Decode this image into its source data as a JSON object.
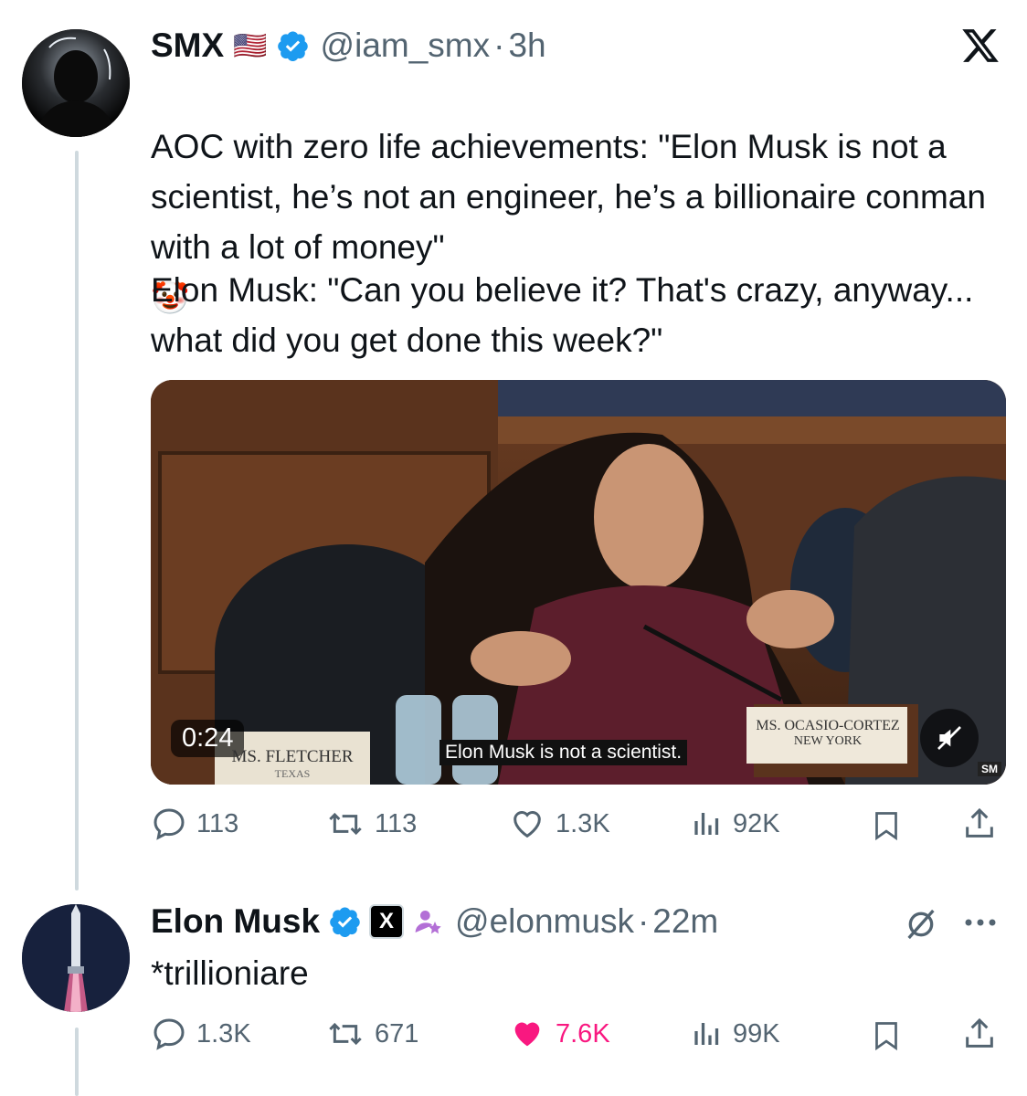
{
  "tweet1": {
    "name": "SMX",
    "flag": "🇺🇸",
    "handle": "@iam_smx",
    "dot": "·",
    "time": "3h",
    "text_p1": "AOC with zero life achievements: \"Elon Musk is not a scientist, he’s not an engineer, he’s a billionaire conman with a lot of money\"",
    "emoji": "🤡",
    "text_p2": "Elon Musk: \"Can you believe it? That's crazy, anyway... what did you get done this week?\"",
    "video": {
      "duration": "0:24",
      "caption": "Elon Musk is not a scientist.",
      "nameplate_left": "MS. FLETCHER",
      "nameplate_left_sub": "TEXAS",
      "nameplate_right": "MS. OCASIO-CORTEZ",
      "nameplate_right_sub": "NEW YORK",
      "corner_text": "SM"
    },
    "replies": "113",
    "reposts": "113",
    "likes": "1.3K",
    "views": "92K"
  },
  "tweet2": {
    "name": "Elon Musk",
    "x_badge": "X",
    "handle": "@elonmusk",
    "dot": "·",
    "time": "22m",
    "text": "*trillioniare",
    "replies": "1.3K",
    "reposts": "671",
    "likes": "7.6K",
    "views": "99K"
  },
  "colors": {
    "verified": "#1d9bf0",
    "liked": "#f91880",
    "muted_text": "#536471",
    "thread_line": "#cfd9de"
  },
  "icons": [
    "verified-badge-icon",
    "x-logo-icon",
    "reply-icon",
    "repost-icon",
    "like-icon",
    "views-icon",
    "bookmark-icon",
    "share-icon",
    "mute-icon",
    "more-icon",
    "grok-icon",
    "affiliate-icon"
  ]
}
